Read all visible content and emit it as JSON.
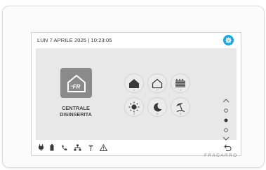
{
  "header": {
    "datetime": "LUN 7 APRILE 2025 | 10:23:05",
    "settings_icon": "gear-icon"
  },
  "colors": {
    "accent": "#1aa6d9",
    "tile": "#8a8a8a",
    "panel": "#e8e8e8"
  },
  "panel": {
    "logo_text": "FR",
    "status_line1": "CENTRALE",
    "status_line2": "DISINSERITA"
  },
  "modes": [
    {
      "icon": "house-filled-icon",
      "number": "1"
    },
    {
      "icon": "house-outline-icon",
      "number": "2"
    },
    {
      "icon": "fence-icon",
      "number": "3"
    },
    {
      "icon": "sun-icon",
      "number": "4"
    },
    {
      "icon": "moon-icon",
      "number": "5"
    },
    {
      "icon": "beach-umbrella-icon",
      "number": "6"
    }
  ],
  "pager": {
    "up_icon": "chevron-up-icon",
    "down_icon": "chevron-down-icon",
    "pages": 3,
    "current_page": 2
  },
  "statusbar": {
    "icons": [
      "plug-icon",
      "battery-icon",
      "phone-icon",
      "network-icon",
      "antenna-icon",
      "warning-icon"
    ],
    "back_icon": "back-arrow-icon"
  },
  "brand": "FRACARRO"
}
